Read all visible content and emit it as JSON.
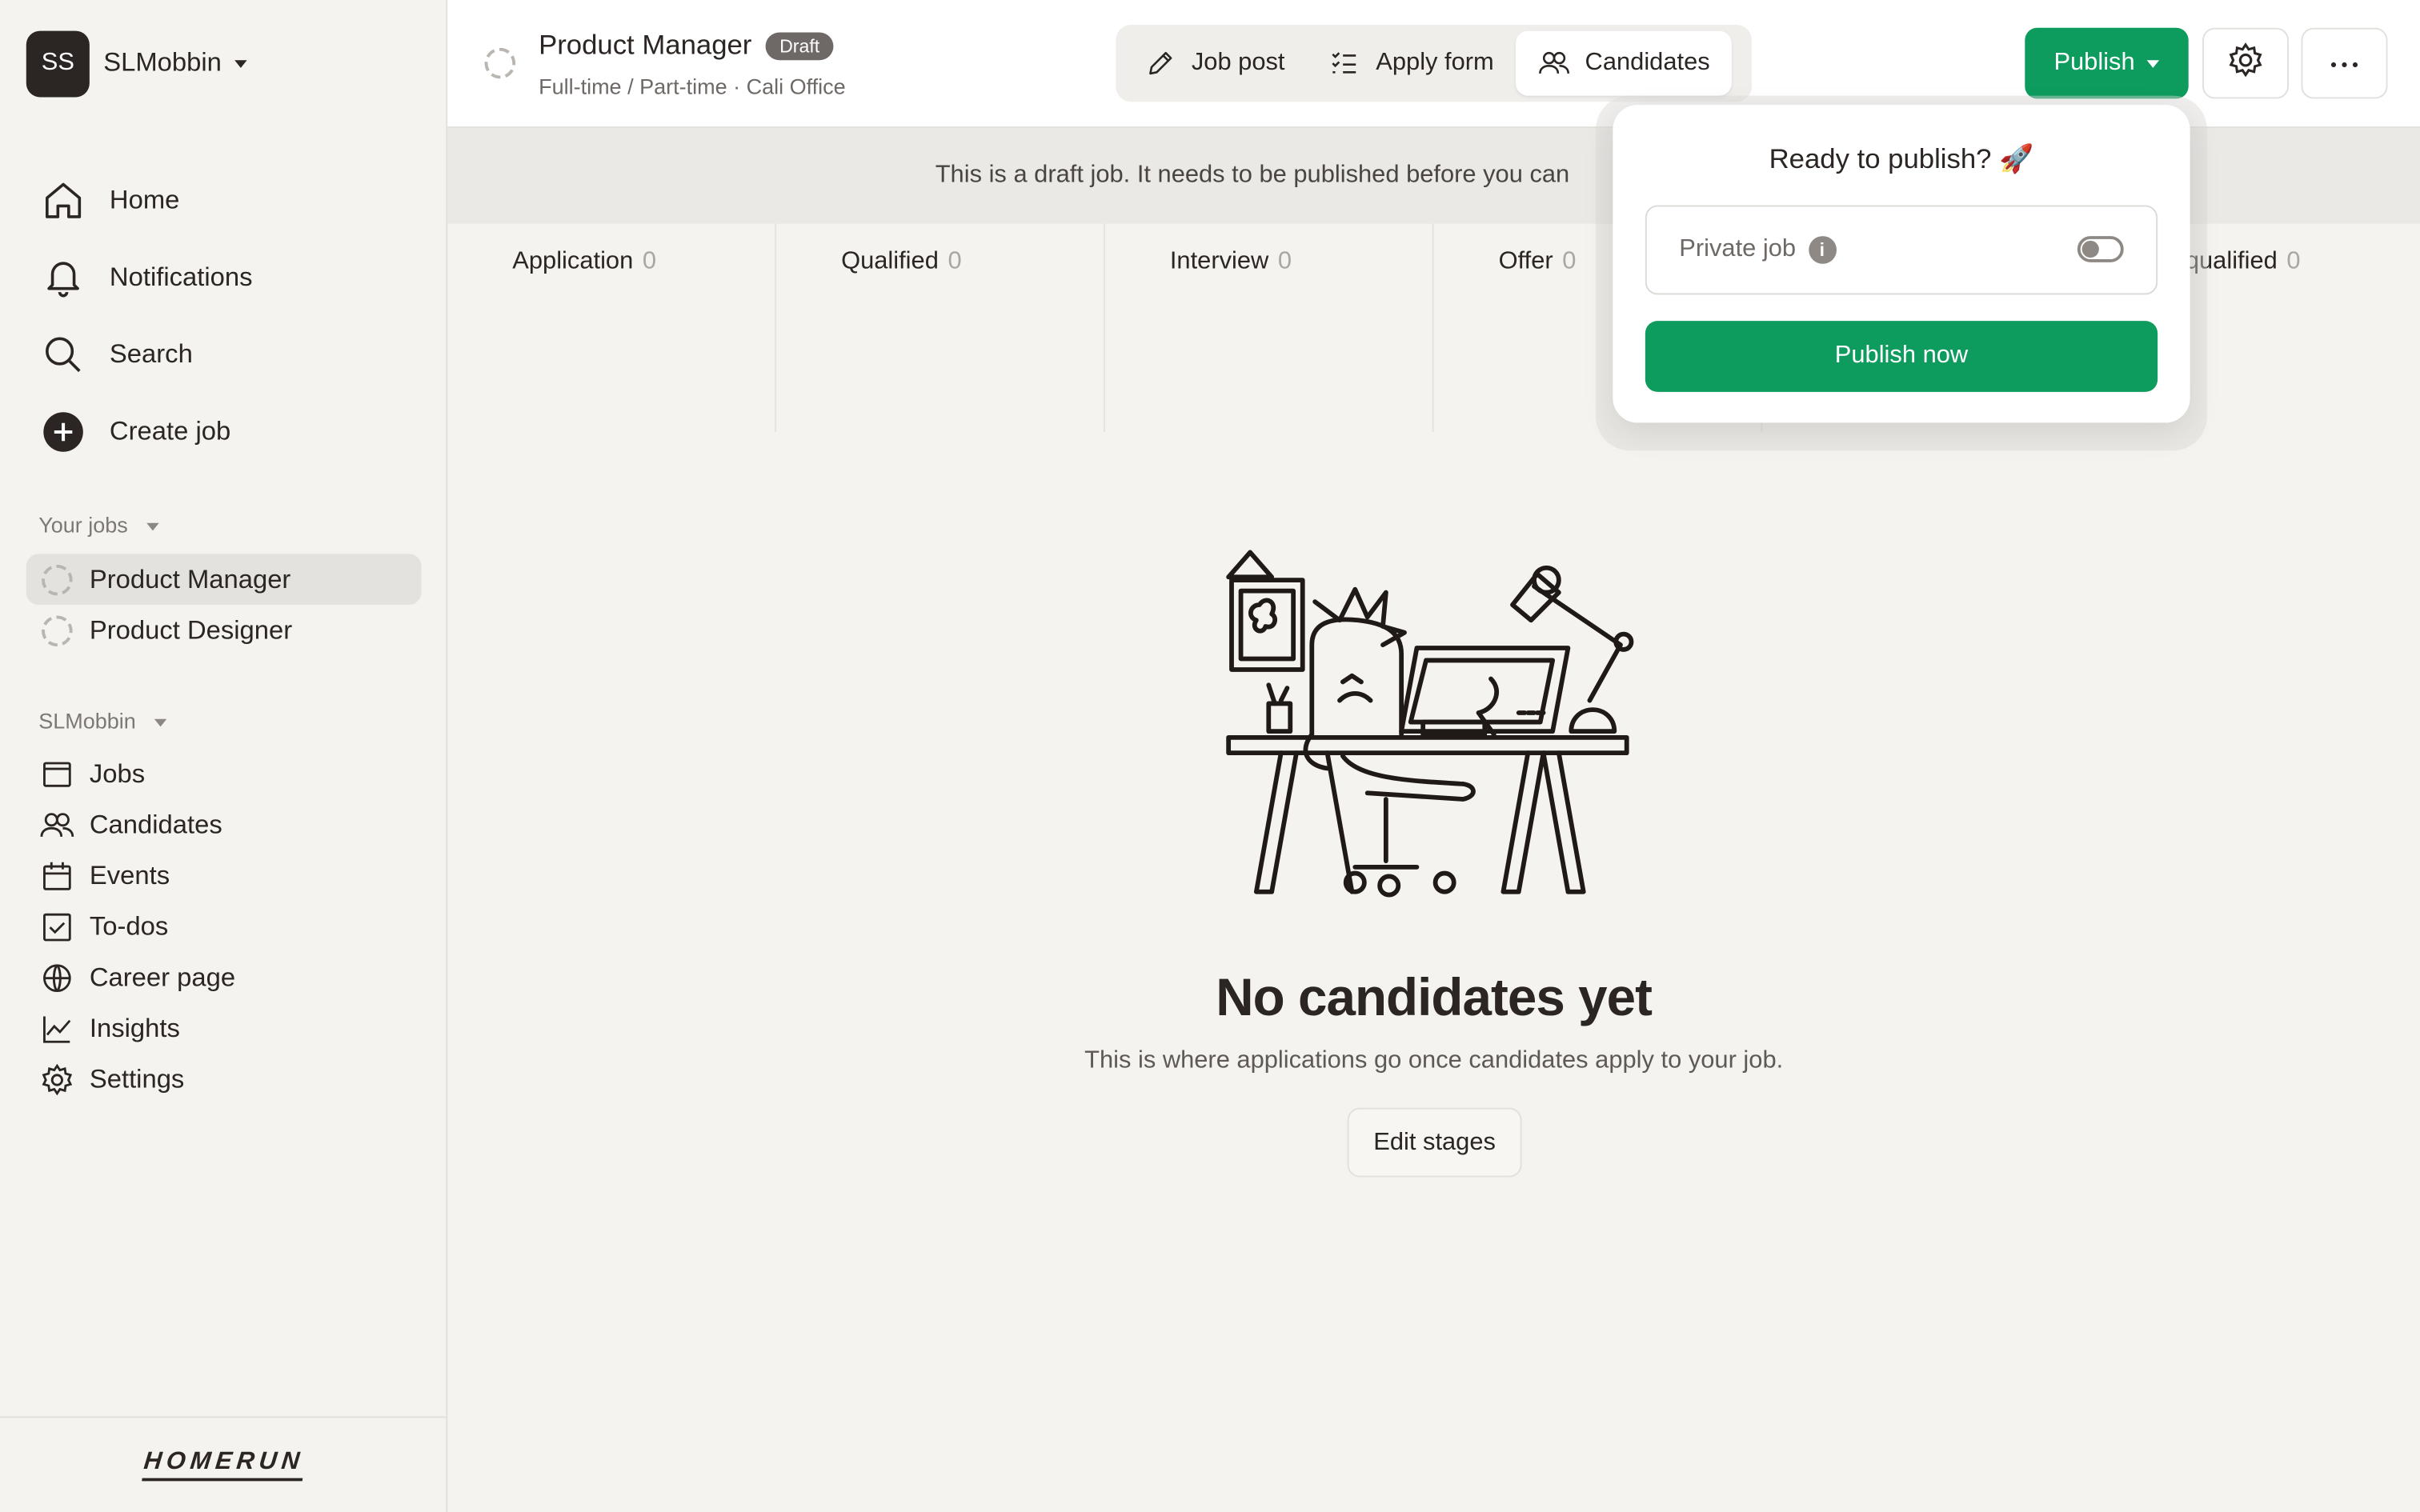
{
  "workspace": {
    "initials": "SS",
    "name": "SLMobbin"
  },
  "nav": {
    "main": [
      {
        "label": "Home",
        "icon": "home-icon"
      },
      {
        "label": "Notifications",
        "icon": "bell-icon"
      },
      {
        "label": "Search",
        "icon": "search-icon"
      },
      {
        "label": "Create job",
        "icon": "plus-circle-icon"
      }
    ],
    "jobs_section": "Your jobs",
    "jobs": [
      "Product Manager",
      "Product Designer"
    ],
    "org_section": "SLMobbin",
    "org": [
      {
        "label": "Jobs",
        "icon": "browser-icon"
      },
      {
        "label": "Candidates",
        "icon": "users-icon"
      },
      {
        "label": "Events",
        "icon": "calendar-icon"
      },
      {
        "label": "To-dos",
        "icon": "checkbox-icon"
      },
      {
        "label": "Career page",
        "icon": "globe-icon"
      },
      {
        "label": "Insights",
        "icon": "chart-icon"
      },
      {
        "label": "Settings",
        "icon": "gear-icon"
      }
    ],
    "logo": "HOMERUN"
  },
  "header": {
    "title": "Product Manager",
    "badge": "Draft",
    "subtitle": "Full-time / Part-time · Cali Office",
    "tabs": [
      {
        "label": "Job post",
        "icon": "pencil-icon"
      },
      {
        "label": "Apply form",
        "icon": "checklist-icon"
      },
      {
        "label": "Candidates",
        "icon": "users-icon",
        "active": true
      }
    ],
    "publish_label": "Publish"
  },
  "banner": "This is a draft job. It needs to be published before you can",
  "stages": [
    {
      "name": "Application",
      "count": "0"
    },
    {
      "name": "Qualified",
      "count": "0"
    },
    {
      "name": "Interview",
      "count": "0"
    },
    {
      "name": "Offer",
      "count": "0"
    }
  ],
  "stage_last": {
    "name": "squalified",
    "count": "0"
  },
  "empty": {
    "title": "No candidates yet",
    "subtitle": "This is where applications go once candidates apply to your job.",
    "button": "Edit stages"
  },
  "popover": {
    "title": "Ready to publish? 🚀",
    "private_label": "Private job",
    "private_enabled": false,
    "button": "Publish now"
  },
  "colors": {
    "accent": "#0e9c5e",
    "text": "#2b2523",
    "bg": "#f4f3ef"
  }
}
